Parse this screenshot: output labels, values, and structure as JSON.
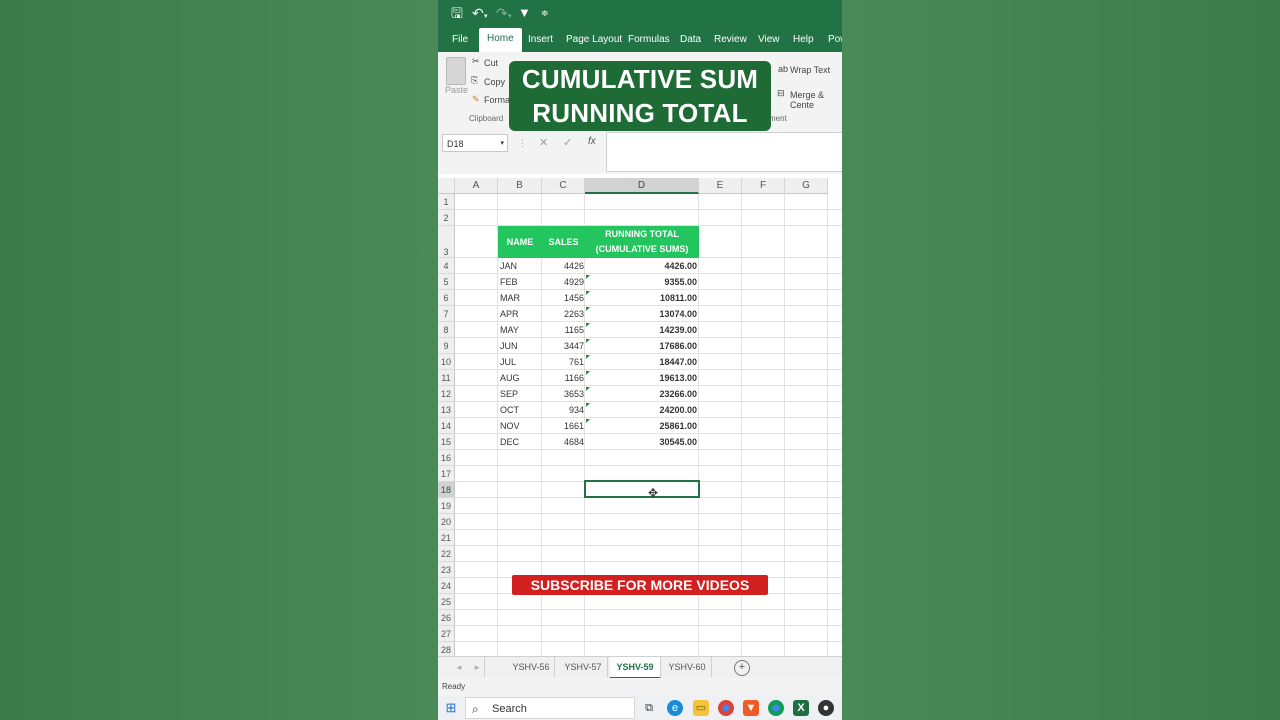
{
  "toolbar": {
    "save_icon": "save-icon",
    "undo_icon": "undo-icon",
    "redo_icon": "redo-icon",
    "filter_icon": "filter-icon",
    "more_icon": "qat-more-icon"
  },
  "menu": {
    "tabs": [
      "File",
      "Home",
      "Insert",
      "Page Layout",
      "Formulas",
      "Data",
      "Review",
      "View",
      "Help",
      "Pow"
    ],
    "active": "Home"
  },
  "ribbon": {
    "paste": "Paste",
    "cut": "Cut",
    "copy": "Copy",
    "format": "Format",
    "clipboard": "Clipboard",
    "wrap_text": "Wrap Text",
    "merge_center": "Merge & Cente",
    "alignment": "ment"
  },
  "overlay": {
    "line1": "CUMULATIVE SUM",
    "line2": "RUNNING TOTAL",
    "subscribe": "SUBSCRIBE FOR MORE VIDEOS"
  },
  "formula_bar": {
    "name_box": "D18",
    "cancel": "✕",
    "enter": "✓",
    "fx": "fx",
    "value": ""
  },
  "sheet": {
    "columns": [
      "A",
      "B",
      "C",
      "D",
      "E",
      "F",
      "G"
    ],
    "rows": [
      "1",
      "2",
      "3",
      "4",
      "5",
      "6",
      "7",
      "8",
      "9",
      "10",
      "11",
      "12",
      "13",
      "14",
      "15",
      "16",
      "17",
      "18",
      "19",
      "20",
      "21",
      "22",
      "23",
      "24",
      "25",
      "26",
      "27",
      "28"
    ],
    "headers": {
      "name": "NAME",
      "sales": "SALES",
      "running_line1": "RUNNING TOTAL",
      "running_line2": "(CUMULATIVE SUMS)"
    },
    "data": [
      {
        "name": "JAN",
        "sales": "4426",
        "total": "4426.00"
      },
      {
        "name": "FEB",
        "sales": "4929",
        "total": "9355.00"
      },
      {
        "name": "MAR",
        "sales": "1456",
        "total": "10811.00"
      },
      {
        "name": "APR",
        "sales": "2263",
        "total": "13074.00"
      },
      {
        "name": "MAY",
        "sales": "1165",
        "total": "14239.00"
      },
      {
        "name": "JUN",
        "sales": "3447",
        "total": "17686.00"
      },
      {
        "name": "JUL",
        "sales": "761",
        "total": "18447.00"
      },
      {
        "name": "AUG",
        "sales": "1166",
        "total": "19613.00"
      },
      {
        "name": "SEP",
        "sales": "3653",
        "total": "23266.00"
      },
      {
        "name": "OCT",
        "sales": "934",
        "total": "24200.00"
      },
      {
        "name": "NOV",
        "sales": "1661",
        "total": "25861.00"
      },
      {
        "name": "DEC",
        "sales": "4684",
        "total": "30545.00"
      }
    ],
    "selected_cell": "D18"
  },
  "sheet_tabs": {
    "tabs": [
      "YSHV-56",
      "YSHV-57",
      "YSHV-59",
      "YSHV-60"
    ],
    "active": "YSHV-59",
    "add": "+"
  },
  "status": {
    "text": "Ready"
  },
  "taskbar": {
    "search": "Search",
    "icons": [
      "windows-icon",
      "task-view-icon",
      "edge-icon",
      "file-explorer-icon",
      "chrome-icon",
      "brave-icon",
      "chrome-icon",
      "excel-icon",
      "obs-icon"
    ]
  },
  "colors": {
    "excel_green": "#217346",
    "header_fill": "#22c55e",
    "banner": "#1f6b35",
    "subscribe": "#d21f1f"
  }
}
